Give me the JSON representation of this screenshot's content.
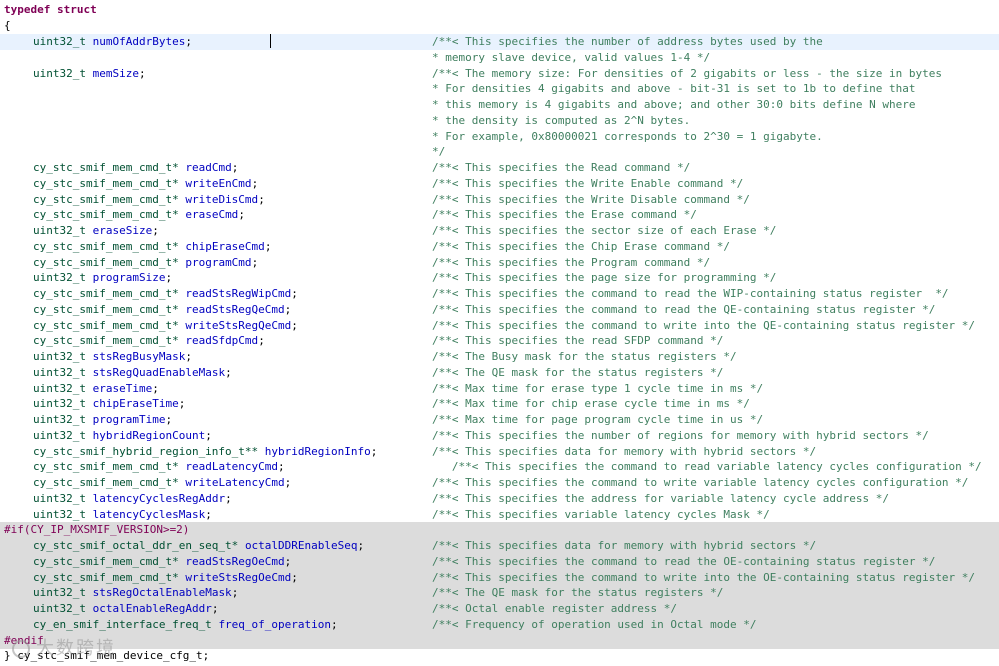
{
  "header": {
    "typedef": "typedef struct",
    "open_brace": "{"
  },
  "lines": [
    {
      "type": "uint32_t",
      "name": "numOfAddrBytes",
      "comment": "/**< This specifies the number of address bytes used by the"
    },
    {
      "comment": "* memory slave device, valid values 1-4 */"
    },
    {
      "type": "uint32_t",
      "name": "memSize",
      "comment": "/**< The memory size: For densities of 2 gigabits or less - the size in bytes"
    },
    {
      "comment": "* For densities 4 gigabits and above - bit-31 is set to 1b to define that"
    },
    {
      "comment": "* this memory is 4 gigabits and above; and other 30:0 bits define N where"
    },
    {
      "comment": "* the density is computed as 2^N bytes."
    },
    {
      "comment": "* For example, 0x80000021 corresponds to 2^30 = 1 gigabyte."
    },
    {
      "comment": "*/"
    },
    {
      "type": "cy_stc_smif_mem_cmd_t*",
      "name": "readCmd",
      "comment": "/**< This specifies the Read command */"
    },
    {
      "type": "cy_stc_smif_mem_cmd_t*",
      "name": "writeEnCmd",
      "comment": "/**< This specifies the Write Enable command */"
    },
    {
      "type": "cy_stc_smif_mem_cmd_t*",
      "name": "writeDisCmd",
      "comment": "/**< This specifies the Write Disable command */"
    },
    {
      "type": "cy_stc_smif_mem_cmd_t*",
      "name": "eraseCmd",
      "comment": "/**< This specifies the Erase command */"
    },
    {
      "type": "uint32_t",
      "name": "eraseSize",
      "comment": "/**< This specifies the sector size of each Erase */"
    },
    {
      "type": "cy_stc_smif_mem_cmd_t*",
      "name": "chipEraseCmd",
      "comment": "/**< This specifies the Chip Erase command */"
    },
    {
      "type": "cy_stc_smif_mem_cmd_t*",
      "name": "programCmd",
      "comment": "/**< This specifies the Program command */"
    },
    {
      "type": "uint32_t",
      "name": "programSize",
      "comment": "/**< This specifies the page size for programming */"
    },
    {
      "type": "cy_stc_smif_mem_cmd_t*",
      "name": "readStsRegWipCmd",
      "comment": "/**< This specifies the command to read the WIP-containing status register  */"
    },
    {
      "type": "cy_stc_smif_mem_cmd_t*",
      "name": "readStsRegQeCmd",
      "comment": "/**< This specifies the command to read the QE-containing status register */"
    },
    {
      "type": "cy_stc_smif_mem_cmd_t*",
      "name": "writeStsRegQeCmd",
      "comment": "/**< This specifies the command to write into the QE-containing status register */"
    },
    {
      "type": "cy_stc_smif_mem_cmd_t*",
      "name": "readSfdpCmd",
      "comment": "/**< This specifies the read SFDP command */"
    },
    {
      "type": "uint32_t",
      "name": "stsRegBusyMask",
      "comment": "/**< The Busy mask for the status registers */"
    },
    {
      "type": "uint32_t",
      "name": "stsRegQuadEnableMask",
      "comment": "/**< The QE mask for the status registers */"
    },
    {
      "type": "uint32_t",
      "name": "eraseTime",
      "comment": "/**< Max time for erase type 1 cycle time in ms */"
    },
    {
      "type": "uint32_t",
      "name": "chipEraseTime",
      "comment": "/**< Max time for chip erase cycle time in ms */"
    },
    {
      "type": "uint32_t",
      "name": "programTime",
      "comment": "/**< Max time for page program cycle time in us */"
    },
    {
      "type": "uint32_t",
      "name": "hybridRegionCount",
      "comment": "/**< This specifies the number of regions for memory with hybrid sectors */"
    },
    {
      "type": "cy_stc_smif_hybrid_region_info_t**",
      "name": "hybridRegionInfo",
      "comment": "/**< This specifies data for memory with hybrid sectors */"
    },
    {
      "type": "cy_stc_smif_mem_cmd_t*",
      "name": "readLatencyCmd",
      "comment": "   /**< This specifies the command to read variable latency cycles configuration */"
    },
    {
      "type": "cy_stc_smif_mem_cmd_t*",
      "name": "writeLatencyCmd",
      "comment": "/**< This specifies the command to write variable latency cycles configuration */"
    },
    {
      "type": "uint32_t",
      "name": "latencyCyclesRegAddr",
      "comment": "/**< This specifies the address for variable latency cycle address */"
    },
    {
      "type": "uint32_t",
      "name": "latencyCyclesMask",
      "comment": "/**< This specifies variable latency cycles Mask */"
    }
  ],
  "preproc_if": "#if(CY_IP_MXSMIF_VERSION>=2)",
  "pp_lines": [
    {
      "type": "cy_stc_smif_octal_ddr_en_seq_t*",
      "name": "octalDDREnableSeq",
      "comment": "/**< This specifies data for memory with hybrid sectors */"
    },
    {
      "type": "cy_stc_smif_mem_cmd_t*",
      "name": "readStsRegOeCmd",
      "comment": "/**< This specifies the command to read the OE-containing status register */"
    },
    {
      "type": "cy_stc_smif_mem_cmd_t*",
      "name": "writeStsRegOeCmd",
      "comment": "/**< This specifies the command to write into the OE-containing status register */"
    },
    {
      "type": "uint32_t",
      "name": "stsRegOctalEnableMask",
      "comment": "/**< The QE mask for the status registers */"
    },
    {
      "type": "uint32_t",
      "name": "octalEnableRegAddr",
      "comment": "/**< Octal enable register address */"
    },
    {
      "type": "cy_en_smif_interface_freq_t",
      "name": "freq_of_operation",
      "comment": "/**< Frequency of operation used in Octal mode */"
    }
  ],
  "preproc_endif": "#endif",
  "footer": "} cy_stc_smif_mem_device_cfg_t;",
  "watermark": "大数跨境"
}
